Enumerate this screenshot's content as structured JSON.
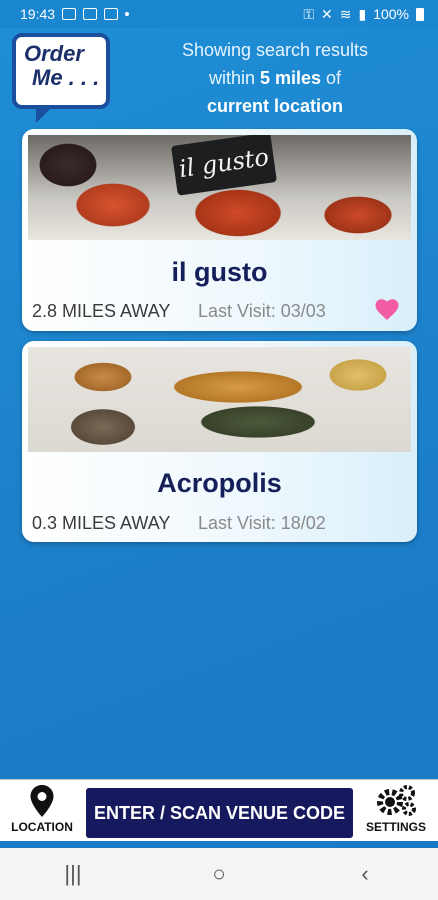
{
  "status_bar": {
    "time": "19:43",
    "battery": "100%",
    "icons": [
      "linkedin-icon",
      "shield-icon",
      "home-icon",
      "dot-icon"
    ],
    "right_icons": [
      "vpn-key-icon",
      "mute-icon",
      "wifi-icon",
      "signal-icon",
      "battery-icon"
    ]
  },
  "header": {
    "logo_line1": "Order",
    "logo_line2": "Me . . .",
    "line1": "Showing search results",
    "line2_prefix": "within ",
    "line2_bold": "5 miles",
    "line2_suffix": " of",
    "line3": "current location"
  },
  "venues": [
    {
      "name": "il gusto",
      "image_sign": "il gusto",
      "distance": "2.8 MILES AWAY",
      "last_visit": "Last Visit: 03/03",
      "favorite": true
    },
    {
      "name": "Acropolis",
      "distance": "0.3 MILES AWAY",
      "last_visit": "Last Visit: 18/02",
      "favorite": false
    }
  ],
  "bottom_bar": {
    "location_label": "LOCATION",
    "venue_button_label": "ENTER / SCAN VENUE CODE",
    "settings_label": "SETTINGS"
  },
  "android_nav": {
    "recents": "|||",
    "home": "○",
    "back": "‹"
  },
  "colors": {
    "background": "#1c84cc",
    "title": "#15205a",
    "venue_button": "#17195e",
    "heart": "#f25ca4"
  }
}
